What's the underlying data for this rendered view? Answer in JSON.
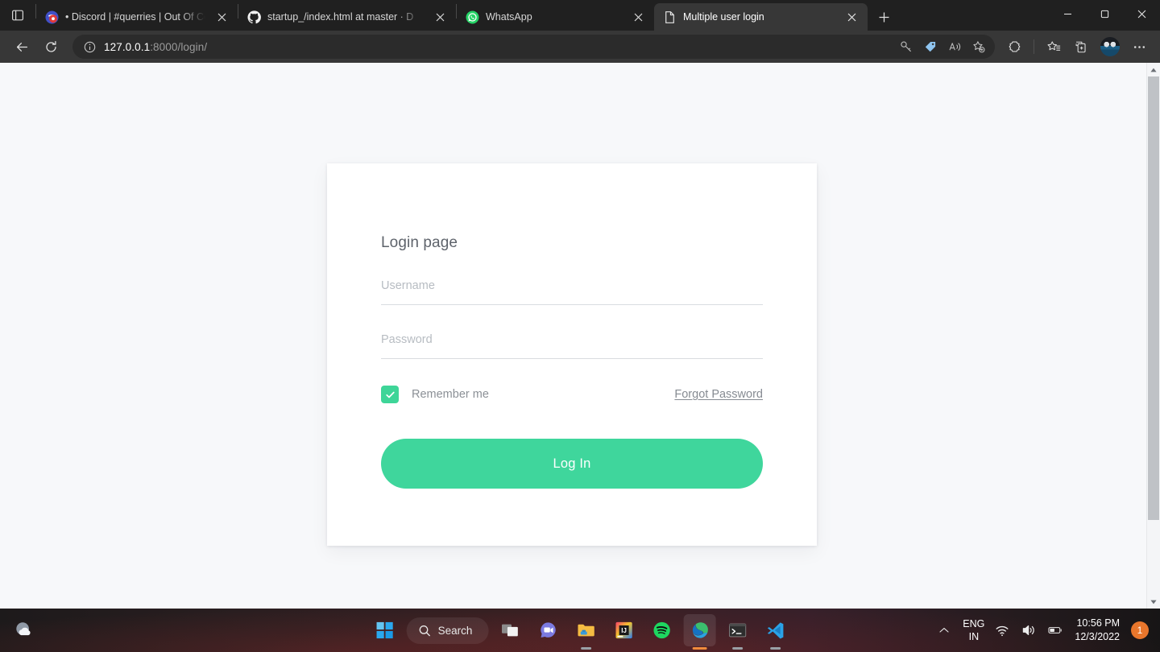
{
  "browser": {
    "tab_search_icon": "tab-search-icon",
    "tabs": [
      {
        "title": "• Discord | #querries | Out Of Co",
        "favicon": "discord-icon",
        "active": false
      },
      {
        "title": "startup_/index.html at master · D",
        "favicon": "github-icon",
        "active": false
      },
      {
        "title": "WhatsApp",
        "favicon": "whatsapp-icon",
        "active": false
      },
      {
        "title": "Multiple user login",
        "favicon": "page-icon",
        "active": true
      }
    ],
    "new_tab_label": "+",
    "window_controls": [
      "minimize",
      "maximize",
      "close"
    ],
    "toolbar": {
      "back_icon": "back-arrow-icon",
      "refresh_icon": "refresh-icon",
      "site_info_icon": "info-icon",
      "url_host": "127.0.0.1",
      "url_path": ":8000/login/",
      "omnibox_icons": [
        "key-icon",
        "shopping-tag-icon",
        "read-aloud-icon",
        "add-favorite-icon"
      ],
      "right_icons": [
        "collections-split-icon",
        "favorites-icon",
        "browser-essentials-icon"
      ],
      "avatar_name": "profile-avatar",
      "settings_icon": "settings-ellipsis-icon"
    }
  },
  "page": {
    "background_color": "#f7f8fa",
    "card": {
      "title": "Login page",
      "username": {
        "label": "Username",
        "placeholder": "Username",
        "value": ""
      },
      "password": {
        "label": "Password",
        "placeholder": "Password",
        "value": ""
      },
      "remember_label": "Remember me",
      "remember_checked": true,
      "checkbox_color": "#3ed598",
      "forgot_label": "Forgot Password",
      "submit_label": "Log In",
      "submit_color": "#3fd69c"
    },
    "scrollbar": {
      "up_arrow": "scroll-up-icon",
      "down_arrow": "scroll-down-icon"
    }
  },
  "taskbar": {
    "weather_icon": "weather-widget-icon",
    "start_icon": "windows-start-icon",
    "search_label": "Search",
    "search_icon": "search-icon",
    "apps": [
      {
        "name": "task-view-icon",
        "running": false
      },
      {
        "name": "teams-chat-icon",
        "running": false
      },
      {
        "name": "file-explorer-icon",
        "running": true
      },
      {
        "name": "intellij-idea-icon",
        "running": false
      },
      {
        "name": "spotify-icon",
        "running": false
      },
      {
        "name": "microsoft-edge-icon",
        "running": true
      },
      {
        "name": "terminal-icon",
        "running": true
      },
      {
        "name": "vs-code-icon",
        "running": true
      }
    ],
    "tray": {
      "chevron_icon": "show-hidden-icons-icon",
      "language_line1": "ENG",
      "language_line2": "IN",
      "wifi_icon": "wifi-icon",
      "volume_icon": "volume-icon",
      "battery_icon": "battery-icon",
      "time": "10:56 PM",
      "date": "12/3/2022",
      "notification_count": "1",
      "notification_color": "#e8762c"
    }
  }
}
